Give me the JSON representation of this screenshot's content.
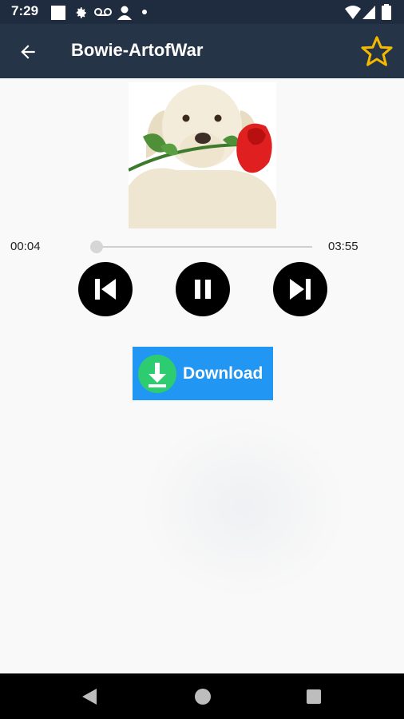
{
  "status_bar": {
    "time": "7:29",
    "icons": [
      "square-icon",
      "settings-icon",
      "voicemail-icon",
      "account-icon",
      "dot-icon",
      "wifi-icon",
      "signal-icon",
      "battery-icon"
    ]
  },
  "app_bar": {
    "title": "Bowie-ArtofWar",
    "back_icon": "arrow-left-icon",
    "favorite_icon": "star-outline-icon",
    "favorite_color": "#f5b800"
  },
  "player": {
    "album_art": "puppy-with-rose",
    "elapsed": "00:04",
    "duration": "03:55",
    "progress": 0.0,
    "controls": [
      "previous",
      "pause",
      "next"
    ]
  },
  "download": {
    "label": "Download",
    "button_color": "#2196f3",
    "icon_color": "#2ecc71"
  },
  "nav_bar": {
    "buttons": [
      "back",
      "home",
      "recents"
    ]
  }
}
